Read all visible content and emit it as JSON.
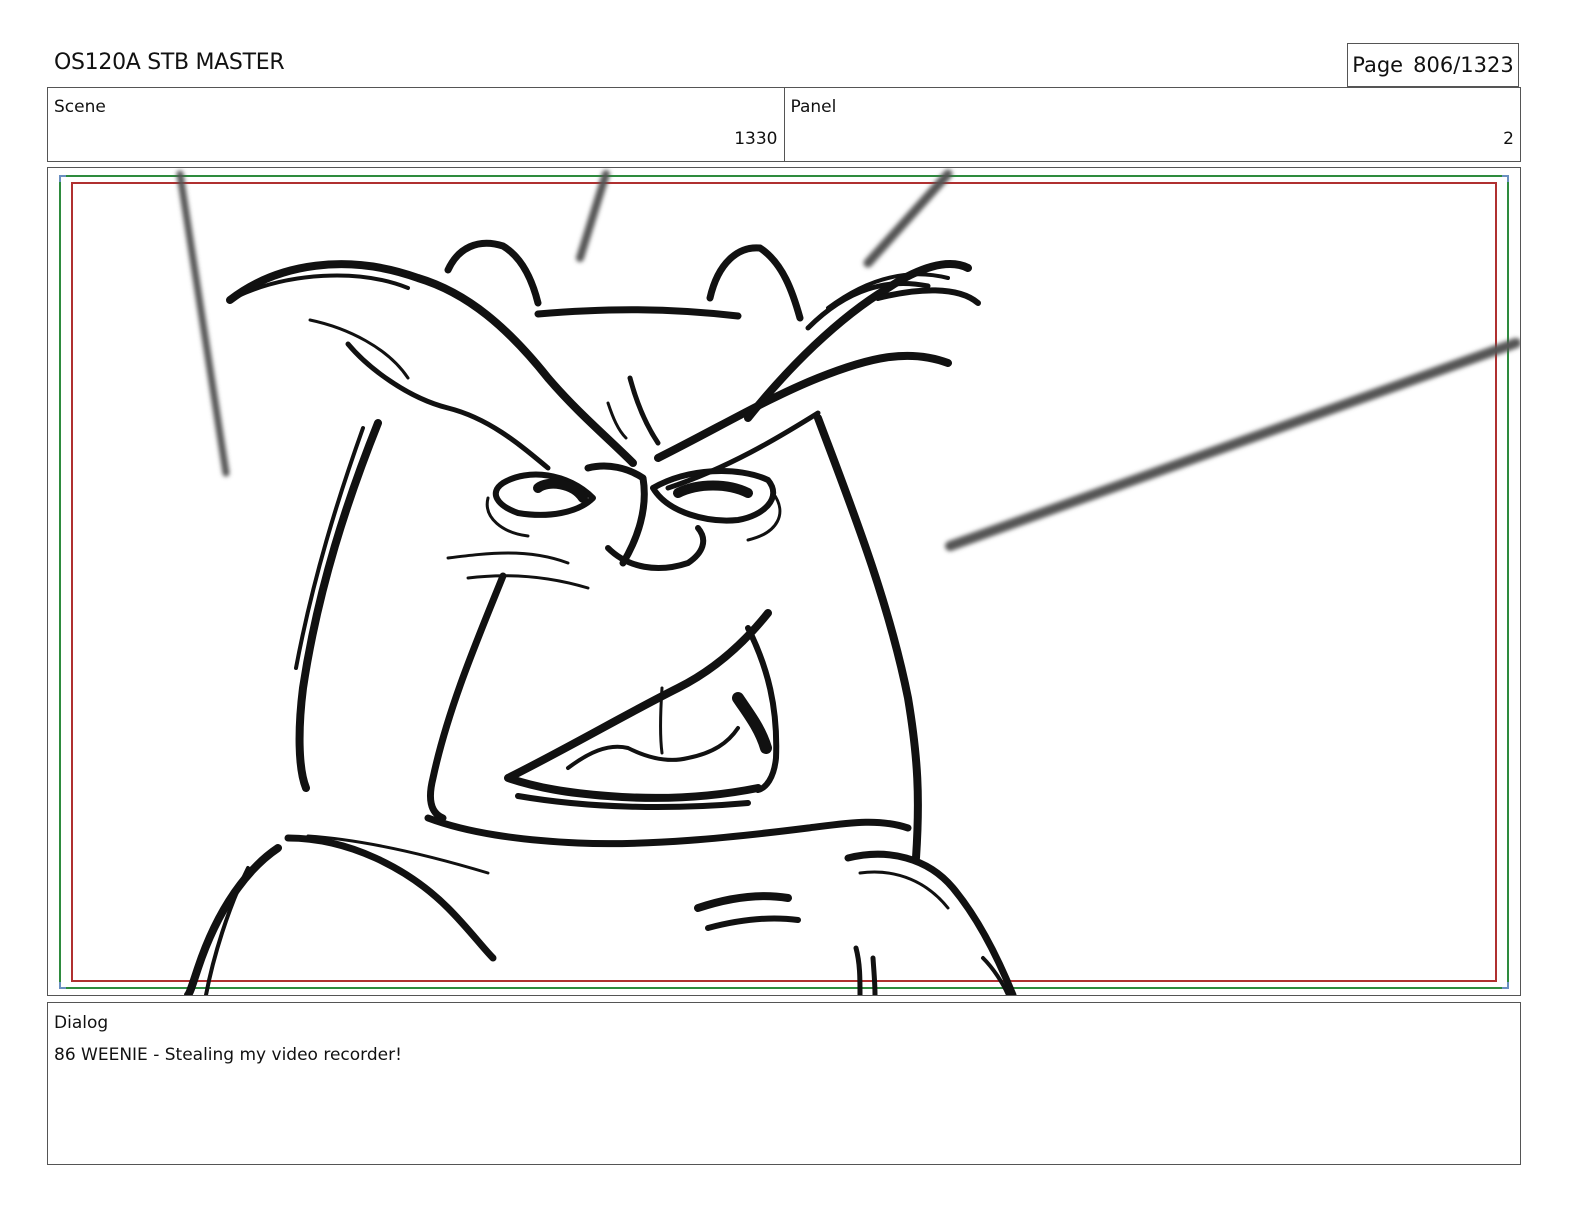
{
  "header": {
    "title": "OS120A STB MASTER",
    "page_label": "Page",
    "page_value": "806/1323"
  },
  "info": {
    "scene_label": "Scene",
    "scene_value": "1330",
    "panel_label": "Panel",
    "panel_value": "2"
  },
  "frame": {
    "safe_area_color": "#2e8b3e",
    "title_safe_color": "#b03030",
    "drawing": "rough storyboard sketch of an angry bird character (Weenie) close-up with motion speed lines"
  },
  "dialog": {
    "label": "Dialog",
    "text": "86 WEENIE - Stealing my video recorder!"
  }
}
